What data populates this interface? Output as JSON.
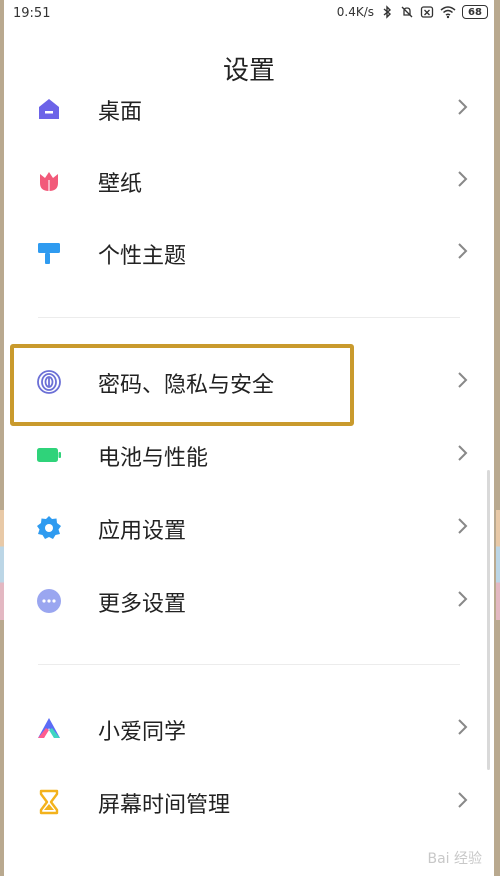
{
  "statusbar": {
    "time": "19:51",
    "network_speed": "0.4K/s",
    "battery": "68",
    "icons": [
      "bluetooth-icon",
      "mute-icon",
      "sim-icon",
      "wifi-icon",
      "battery-icon"
    ]
  },
  "header": {
    "title": "设置"
  },
  "settings": {
    "desktop": {
      "label": "桌面",
      "icon": "home-icon",
      "color": "#6c63e8"
    },
    "wallpaper": {
      "label": "壁纸",
      "icon": "tulip-icon",
      "color": "#f25a7a"
    },
    "theme": {
      "label": "个性主题",
      "icon": "paint-roller-icon",
      "color": "#2f9bf0"
    },
    "privacy": {
      "label": "密码、隐私与安全",
      "icon": "fingerprint-icon",
      "color": "#6b6fd6"
    },
    "battery": {
      "label": "电池与性能",
      "icon": "battery-icon",
      "color": "#2fd37a"
    },
    "apps": {
      "label": "应用设置",
      "icon": "gear-icon",
      "color": "#2f9bf0"
    },
    "more": {
      "label": "更多设置",
      "icon": "more-dots-icon",
      "color": "#9aa6f0"
    },
    "xiaoai": {
      "label": "小爱同学",
      "icon": "xiaoai-icon",
      "color": "#5b6cf6"
    },
    "screentime": {
      "label": "屏幕时间管理",
      "icon": "hourglass-icon",
      "color": "#f3b21c"
    }
  },
  "highlight_color": "#c99a2d",
  "watermark": "Bai 经验"
}
